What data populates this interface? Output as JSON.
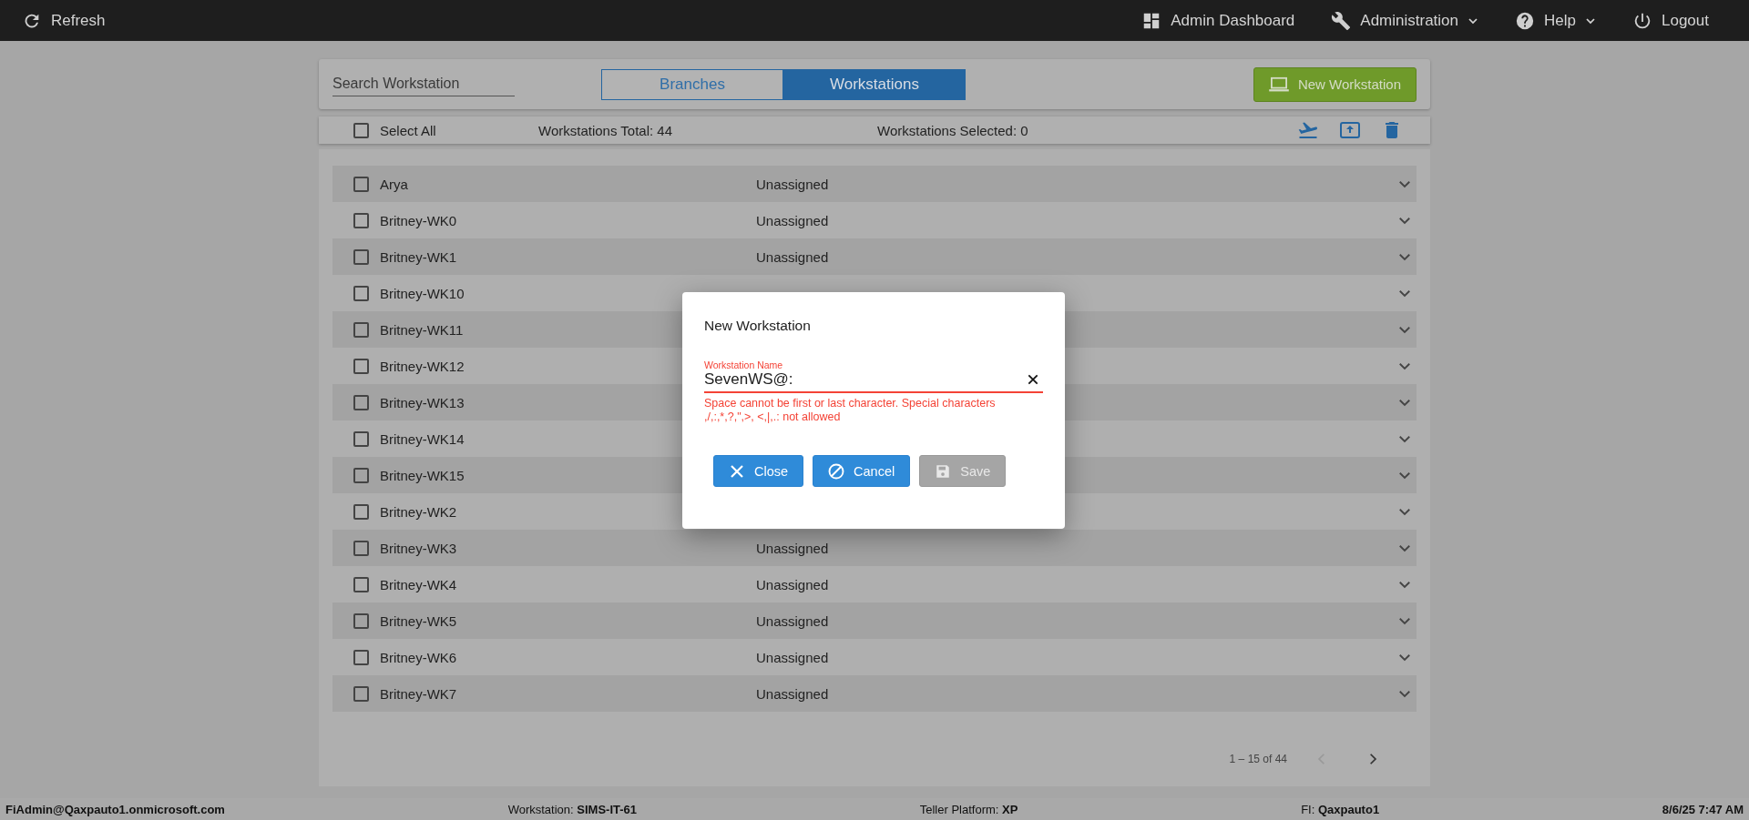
{
  "top_bar": {
    "left": [
      {
        "label": "Refresh",
        "kind": "refresh"
      }
    ],
    "right": [
      {
        "label": "Admin Dashboard",
        "kind": "dashboard",
        "dropdown": false
      },
      {
        "label": "Administration",
        "kind": "wrench",
        "dropdown": true
      },
      {
        "label": "Help",
        "kind": "help",
        "dropdown": true
      },
      {
        "label": "Logout",
        "kind": "power",
        "dropdown": false
      }
    ]
  },
  "search": {
    "placeholder": "Search Workstation"
  },
  "tabs": [
    {
      "label": "Branches",
      "selected": false
    },
    {
      "label": "Workstations",
      "selected": true
    }
  ],
  "new_button": {
    "label": "New Workstation"
  },
  "summary": {
    "select_all": {
      "label": "Select All",
      "checked": false
    },
    "total": "Workstations Total: 44",
    "selected_count": "Workstations Selected: 0"
  },
  "rows": [
    {
      "name": "Arya",
      "status": "Unassigned",
      "checked": false,
      "expanded": false
    },
    {
      "name": "Britney-WK0",
      "status": "Unassigned",
      "checked": false,
      "expanded": false
    },
    {
      "name": "Britney-WK1",
      "status": "Unassigned",
      "checked": false,
      "expanded": false
    },
    {
      "name": "Britney-WK10",
      "checked": false,
      "expanded": false
    },
    {
      "name": "Britney-WK11",
      "checked": false,
      "expanded": false
    },
    {
      "name": "Britney-WK12",
      "checked": false,
      "expanded": false
    },
    {
      "name": "Britney-WK13",
      "checked": false,
      "expanded": false
    },
    {
      "name": "Britney-WK14",
      "checked": false,
      "expanded": false
    },
    {
      "name": "Britney-WK15",
      "checked": false,
      "expanded": false
    },
    {
      "name": "Britney-WK2",
      "checked": false,
      "expanded": false
    },
    {
      "name": "Britney-WK3",
      "status": "Unassigned",
      "checked": false,
      "expanded": false
    },
    {
      "name": "Britney-WK4",
      "status": "Unassigned",
      "checked": false,
      "expanded": false
    },
    {
      "name": "Britney-WK5",
      "status": "Unassigned",
      "checked": false,
      "expanded": false
    },
    {
      "name": "Britney-WK6",
      "status": "Unassigned",
      "checked": false,
      "expanded": false
    },
    {
      "name": "Britney-WK7",
      "status": "Unassigned",
      "checked": false,
      "expanded": false
    }
  ],
  "pagination": {
    "range": "1 – 15 of 44",
    "prev_disabled": true,
    "next_disabled": false
  },
  "dialog": {
    "title": "New Workstation",
    "field": {
      "label": "Workstation Name",
      "value": "SevenWS@:",
      "invalid": true,
      "error": "Space cannot be first or last character. Special characters ,/,:,*,?,\",>, <,|,.: not allowed"
    },
    "buttons": [
      {
        "label": "Close",
        "kind": "close",
        "disabled": false
      },
      {
        "label": "Cancel",
        "kind": "cancel",
        "disabled": false
      },
      {
        "label": "Save",
        "kind": "save",
        "disabled": true
      }
    ]
  },
  "status_bar": [
    {
      "label": "FiAdmin@Qaxpauto1.onmicrosoft.com"
    },
    {
      "label": "Workstation:",
      "value": "SIMS-IT-61"
    },
    {
      "label": "Teller Platform:",
      "value": "XP"
    },
    {
      "label": "FI:",
      "value": "Qaxpauto1"
    },
    {
      "label": "8/6/25 7:47 AM"
    }
  ]
}
